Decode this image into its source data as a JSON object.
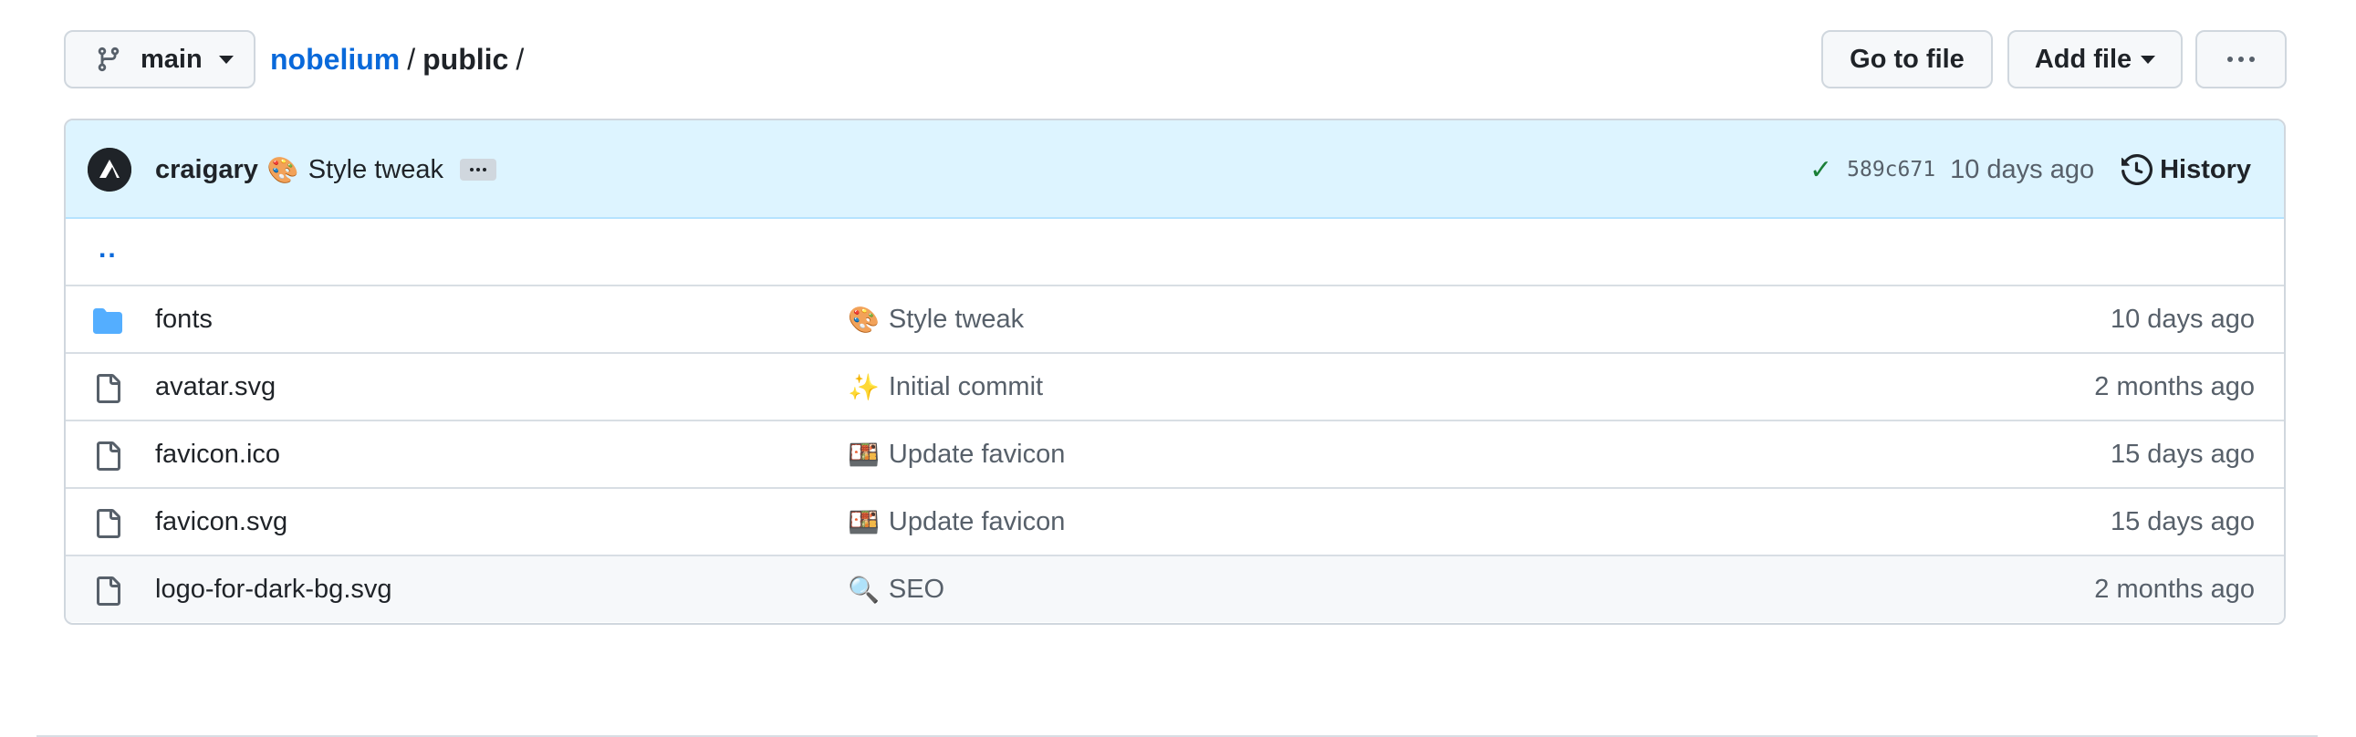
{
  "branch": {
    "name": "main",
    "icon": "git-branch-icon"
  },
  "breadcrumb": {
    "repo": "nobelium",
    "separator": "/",
    "dir": "public",
    "trailing": "/"
  },
  "actions": {
    "go_to_file": "Go to file",
    "add_file": "Add file",
    "more_icon": "kebab-horizontal-icon"
  },
  "commit": {
    "author": "craigary",
    "emoji": "🎨",
    "message": "Style tweak",
    "status_icon": "check-icon",
    "sha": "589c671",
    "time": "10 days ago",
    "history_label": "History"
  },
  "parent_dir": "..",
  "files": [
    {
      "type": "folder",
      "name": "fonts",
      "emoji": "🎨",
      "message": "Style tweak",
      "time": "10 days ago"
    },
    {
      "type": "file",
      "name": "avatar.svg",
      "emoji": "✨",
      "message": "Initial commit",
      "time": "2 months ago"
    },
    {
      "type": "file",
      "name": "favicon.ico",
      "emoji": "🍱",
      "message": "Update favicon",
      "time": "15 days ago"
    },
    {
      "type": "file",
      "name": "favicon.svg",
      "emoji": "🍱",
      "message": "Update favicon",
      "time": "15 days ago"
    },
    {
      "type": "file",
      "name": "logo-for-dark-bg.svg",
      "emoji": "🔍",
      "message": "SEO",
      "time": "2 months ago"
    }
  ],
  "colors": {
    "accent": "#0969da",
    "commit_bar": "#ddf4ff",
    "success": "#1a7f37",
    "folder": "#54aeff"
  }
}
